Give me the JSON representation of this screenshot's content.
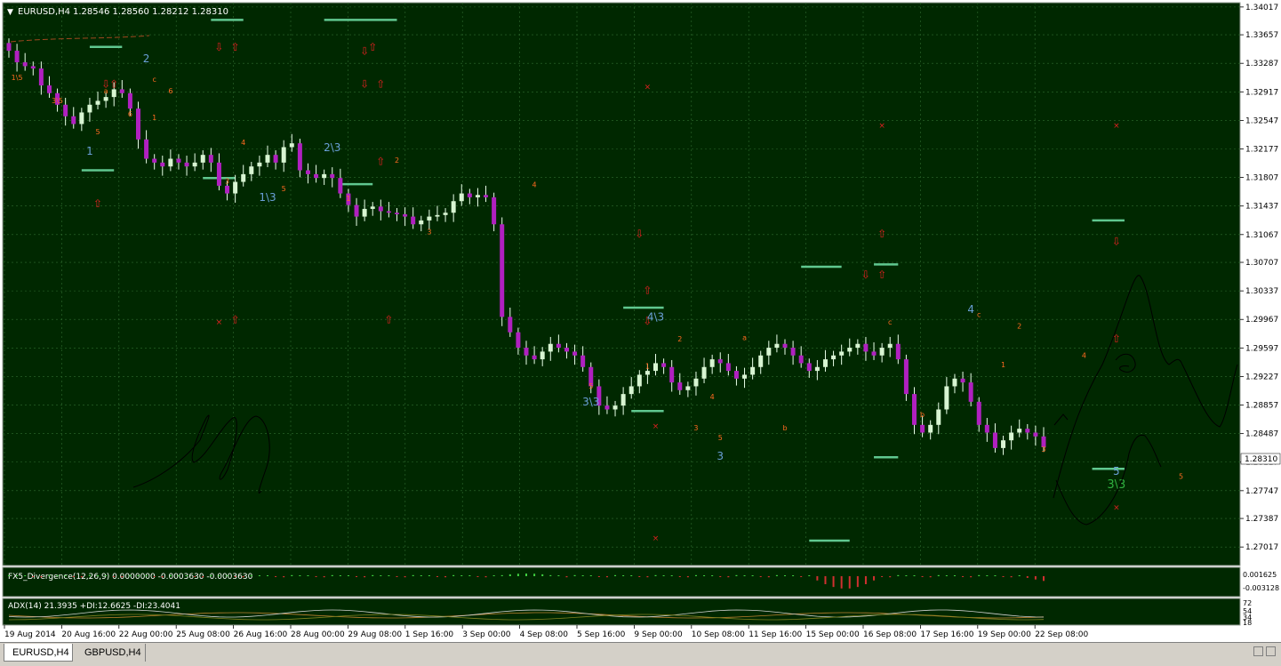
{
  "window": {
    "symbol_label": "EURUSD,H4",
    "ohlc_label": "1.28546 1.28560 1.28212 1.28310"
  },
  "colors": {
    "background": "#002800",
    "grid": "#2f6b2f",
    "bull_candle": "#d8f5d2",
    "bear_candle": "#b020c0",
    "wave_orange": "#ff6a20",
    "wave_blue": "#6aa0d8",
    "level_line": "#60c890",
    "arrow_red": "#e02020",
    "text": "#ffffff"
  },
  "chart_data": [
    {
      "type": "candlestick",
      "symbol": "EURUSD",
      "timeframe": "H4",
      "ylim": [
        1.268,
        1.3405
      ],
      "last_price": 1.2831,
      "last_price_label": "1.28310",
      "price_ticks": [
        "1.34017",
        "1.33657",
        "1.33287",
        "1.32917",
        "1.32547",
        "1.32177",
        "1.31807",
        "1.31437",
        "1.31067",
        "1.30707",
        "1.30337",
        "1.29967",
        "1.29597",
        "1.29227",
        "1.28857",
        "1.28487",
        "1.28117",
        "1.27747",
        "1.27387",
        "1.27017"
      ],
      "time_ticks": [
        "19 Aug 2014",
        "20 Aug 16:00",
        "22 Aug 00:00",
        "25 Aug 08:00",
        "26 Aug 16:00",
        "28 Aug 00:00",
        "29 Aug 08:00",
        "1 Sep 16:00",
        "3 Sep 00:00",
        "4 Sep 08:00",
        "5 Sep 16:00",
        "9 Sep 00:00",
        "10 Sep 08:00",
        "11 Sep 16:00",
        "15 Sep 00:00",
        "16 Sep 08:00",
        "17 Sep 16:00",
        "19 Sep 00:00",
        "22 Sep 08:00"
      ],
      "closes": [
        1.3345,
        1.333,
        1.3325,
        1.3322,
        1.33,
        1.329,
        1.3275,
        1.326,
        1.325,
        1.3265,
        1.3275,
        1.328,
        1.3285,
        1.3295,
        1.329,
        1.327,
        1.323,
        1.3205,
        1.32,
        1.3195,
        1.3205,
        1.32,
        1.3195,
        1.32,
        1.321,
        1.32,
        1.317,
        1.316,
        1.3175,
        1.3185,
        1.3195,
        1.32,
        1.321,
        1.32,
        1.322,
        1.3225,
        1.319,
        1.3185,
        1.318,
        1.3185,
        1.318,
        1.316,
        1.3145,
        1.313,
        1.314,
        1.3143,
        1.3137,
        1.3135,
        1.3133,
        1.313,
        1.312,
        1.3125,
        1.313,
        1.3132,
        1.3135,
        1.315,
        1.316,
        1.3155,
        1.3158,
        1.3155,
        1.312,
        1.3,
        1.298,
        1.296,
        1.295,
        1.2945,
        1.2955,
        1.2965,
        1.296,
        1.2955,
        1.295,
        1.2935,
        1.291,
        1.2885,
        1.288,
        1.2885,
        1.29,
        1.291,
        1.2925,
        1.293,
        1.294,
        1.2935,
        1.2915,
        1.2905,
        1.291,
        1.292,
        1.2935,
        1.2945,
        1.294,
        1.293,
        1.292,
        1.2925,
        1.2935,
        1.295,
        1.296,
        1.2965,
        1.296,
        1.295,
        1.294,
        1.293,
        1.2935,
        1.2945,
        1.295,
        1.2955,
        1.296,
        1.2965,
        1.2955,
        1.295,
        1.296,
        1.2965,
        1.2945,
        1.29,
        1.286,
        1.285,
        1.286,
        1.288,
        1.291,
        1.292,
        1.2915,
        1.289,
        1.286,
        1.285,
        1.283,
        1.284,
        1.285,
        1.2855,
        1.285,
        1.2845,
        1.2831
      ],
      "divergence_indicator": {
        "label": "FX5_Divergence(12,26,9) 0.0000000 -0.0003630 -0.0003630",
        "ticks": [
          "0.001625",
          "-0.003128"
        ]
      },
      "adx_indicator": {
        "label": "ADX(14) 21.3935 +DI:12.6625 -DI:23.4041",
        "ticks": [
          "72",
          "54",
          "34",
          "18"
        ]
      },
      "wave_labels": [
        {
          "text": "1",
          "color": "blue",
          "i": 10,
          "p": 1.321
        },
        {
          "text": "2",
          "color": "blue",
          "i": 17,
          "p": 1.333
        },
        {
          "text": "2\\3",
          "color": "blue",
          "i": 40,
          "p": 1.3215
        },
        {
          "text": "1\\3",
          "color": "blue",
          "i": 32,
          "p": 1.315
        },
        {
          "text": "4\\3",
          "color": "blue",
          "i": 80,
          "p": 1.2995
        },
        {
          "text": "3\\3",
          "color": "blue",
          "i": 72,
          "p": 1.2885
        },
        {
          "text": "3",
          "color": "blue",
          "i": 88,
          "p": 1.2815
        },
        {
          "text": "4",
          "color": "blue",
          "i": 119,
          "p": 1.3005
        },
        {
          "text": "5",
          "color": "blue",
          "i": 137,
          "p": 1.2795
        },
        {
          "text": "3\\3",
          "color": "green",
          "i": 137,
          "p": 1.2778
        },
        {
          "text": "1\\5",
          "color": "orange",
          "i": 1,
          "p": 1.3307
        },
        {
          "text": "3\\5",
          "color": "orange",
          "i": 6,
          "p": 1.3277
        },
        {
          "text": "5",
          "color": "orange",
          "i": 11,
          "p": 1.3237
        },
        {
          "text": "a",
          "color": "orange",
          "i": 12,
          "p": 1.329
        },
        {
          "text": "6",
          "color": "orange",
          "i": 15,
          "p": 1.326
        },
        {
          "text": "c",
          "color": "orange",
          "i": 18,
          "p": 1.3305
        },
        {
          "text": "6",
          "color": "orange",
          "i": 20,
          "p": 1.329
        },
        {
          "text": "1",
          "color": "orange",
          "i": 18,
          "p": 1.3255
        },
        {
          "text": "4",
          "color": "orange",
          "i": 29,
          "p": 1.3223
        },
        {
          "text": "3",
          "color": "orange",
          "i": 27,
          "p": 1.3173
        },
        {
          "text": "5",
          "color": "orange",
          "i": 34,
          "p": 1.3163
        },
        {
          "text": "1",
          "color": "orange",
          "i": 42,
          "p": 1.315
        },
        {
          "text": "2",
          "color": "orange",
          "i": 48,
          "p": 1.32
        },
        {
          "text": "3",
          "color": "orange",
          "i": 52,
          "p": 1.3107
        },
        {
          "text": "4",
          "color": "orange",
          "i": 65,
          "p": 1.3168
        },
        {
          "text": "5",
          "color": "orange",
          "i": 72,
          "p": 1.2907
        },
        {
          "text": "1",
          "color": "orange",
          "i": 79,
          "p": 1.2933
        },
        {
          "text": "2",
          "color": "orange",
          "i": 83,
          "p": 1.2968
        },
        {
          "text": "3",
          "color": "orange",
          "i": 85,
          "p": 1.2853
        },
        {
          "text": "4",
          "color": "orange",
          "i": 87,
          "p": 1.2893
        },
        {
          "text": "5",
          "color": "orange",
          "i": 88,
          "p": 1.284
        },
        {
          "text": "a",
          "color": "orange",
          "i": 91,
          "p": 1.297
        },
        {
          "text": "b",
          "color": "orange",
          "i": 96,
          "p": 1.2853
        },
        {
          "text": "c",
          "color": "orange",
          "i": 109,
          "p": 1.299
        },
        {
          "text": "b",
          "color": "orange",
          "i": 113,
          "p": 1.287
        },
        {
          "text": "c",
          "color": "orange",
          "i": 120,
          "p": 1.3
        },
        {
          "text": "1",
          "color": "orange",
          "i": 123,
          "p": 1.2935
        },
        {
          "text": "2",
          "color": "orange",
          "i": 125,
          "p": 1.2985
        },
        {
          "text": "3",
          "color": "orange",
          "i": 128,
          "p": 1.2825
        },
        {
          "text": "4",
          "color": "orange",
          "i": 133,
          "p": 1.2947
        },
        {
          "text": "5",
          "color": "orange",
          "i": 145,
          "p": 1.279
        }
      ],
      "level_lines": [
        {
          "i0": 10,
          "i1": 14,
          "p": 1.335
        },
        {
          "i0": 25,
          "i1": 29,
          "p": 1.3385
        },
        {
          "i0": 39,
          "i1": 48,
          "p": 1.3385
        },
        {
          "i0": 9,
          "i1": 13,
          "p": 1.319
        },
        {
          "i0": 24,
          "i1": 28,
          "p": 1.318
        },
        {
          "i0": 41,
          "i1": 45,
          "p": 1.3172
        },
        {
          "i0": 76,
          "i1": 81,
          "p": 1.3012
        },
        {
          "i0": 77,
          "i1": 81,
          "p": 1.2878
        },
        {
          "i0": 98,
          "i1": 103,
          "p": 1.3065
        },
        {
          "i0": 107,
          "i1": 110,
          "p": 1.3068
        },
        {
          "i0": 107,
          "i1": 110,
          "p": 1.2818
        },
        {
          "i0": 99,
          "i1": 104,
          "p": 1.271
        },
        {
          "i0": 134,
          "i1": 138,
          "p": 1.3125
        },
        {
          "i0": 134,
          "i1": 138,
          "p": 1.2803
        }
      ],
      "up_arrows": [
        {
          "i": 28,
          "p": 1.3345
        },
        {
          "i": 45,
          "p": 1.3345
        },
        {
          "i": 46,
          "p": 1.3297
        },
        {
          "i": 13,
          "p": 1.3297
        },
        {
          "i": 46,
          "p": 1.3197
        },
        {
          "i": 11,
          "p": 1.3142
        },
        {
          "i": 28,
          "p": 1.2992
        },
        {
          "i": 47,
          "p": 1.2992
        },
        {
          "i": 79,
          "p": 1.303
        },
        {
          "i": 108,
          "p": 1.3103
        },
        {
          "i": 108,
          "p": 1.305
        },
        {
          "i": 137,
          "p": 1.2967
        }
      ],
      "down_arrows": [
        {
          "i": 26,
          "p": 1.3345
        },
        {
          "i": 44,
          "p": 1.334
        },
        {
          "i": 44,
          "p": 1.3297
        },
        {
          "i": 12,
          "p": 1.3297
        },
        {
          "i": 78,
          "p": 1.3103
        },
        {
          "i": 106,
          "p": 1.305
        },
        {
          "i": 137,
          "p": 1.3093
        },
        {
          "i": 79,
          "p": 1.299
        }
      ],
      "cross_marks": [
        {
          "i": 79,
          "p": 1.3295
        },
        {
          "i": 108,
          "p": 1.3245
        },
        {
          "i": 137,
          "p": 1.3245
        },
        {
          "i": 26,
          "p": 1.299
        },
        {
          "i": 80,
          "p": 1.2855
        },
        {
          "i": 137,
          "p": 1.275
        },
        {
          "i": 80,
          "p": 1.271
        }
      ]
    }
  ],
  "tabs": [
    {
      "label": "EURUSD,H4",
      "active": true
    },
    {
      "label": "GBPUSD,H4",
      "active": false
    }
  ]
}
